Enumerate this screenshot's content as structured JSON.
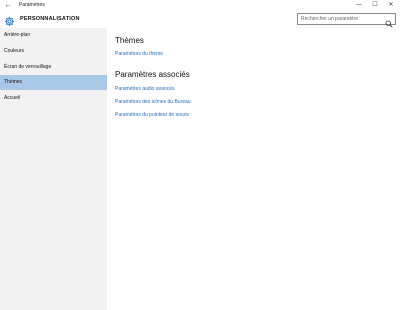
{
  "window": {
    "title": "Paramètres",
    "back_glyph": "←",
    "minimize_glyph": "—",
    "maximize_glyph": "☐",
    "close_glyph": "✕"
  },
  "header": {
    "title": "PERSONNALISATION",
    "icon": "gear-icon"
  },
  "search": {
    "placeholder": "Rechercher un paramètre",
    "value": "",
    "icon": "search-icon"
  },
  "sidebar": {
    "selected_index": 3,
    "selected_color": "#a9c8e8",
    "items": [
      {
        "label": "Arrière-plan"
      },
      {
        "label": "Couleurs"
      },
      {
        "label": "Écran de verrouillage"
      },
      {
        "label": "Thèmes"
      },
      {
        "label": "Accueil"
      }
    ]
  },
  "main": {
    "themes_section": {
      "title": "Thèmes",
      "links": [
        "Paramètres du thème"
      ]
    },
    "related_section": {
      "title": "Paramètres associés",
      "links": [
        "Paramètres audio avancés",
        "Paramètres des icônes du Bureau",
        "Paramètres du pointeur de souris"
      ]
    },
    "link_color": "#1f6fc0"
  }
}
